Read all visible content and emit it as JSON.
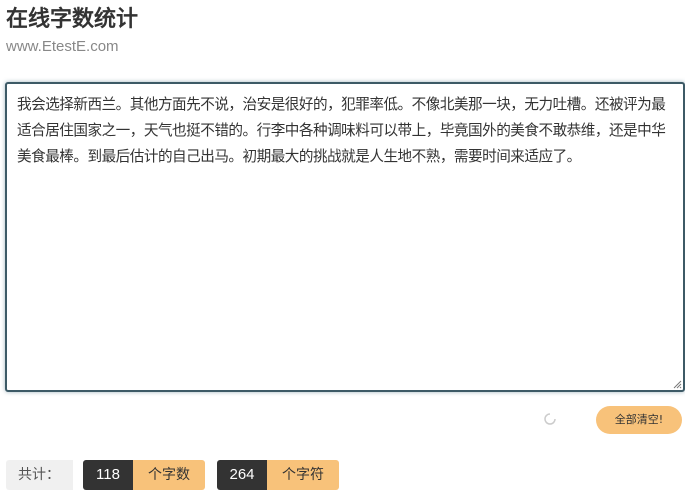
{
  "header": {
    "title": "在线字数统计",
    "subtitle": "www.EtestE.com"
  },
  "editor": {
    "value": "我会选择新西兰。其他方面先不说，治安是很好的，犯罪率低。不像北美那一块，无力吐槽。还被评为最适合居住国家之一，天气也挺不错的。行李中各种调味料可以带上，毕竟国外的美食不敢恭维，还是中华美食最棒。到最后估计的自己出马。初期最大的挑战就是人生地不熟，需要时间来适应了。"
  },
  "actions": {
    "clear_label": "全部清空!"
  },
  "stats": {
    "label": "共计：",
    "words_count": "118",
    "words_unit": "个字数",
    "chars_count": "264",
    "chars_unit": "个字符"
  },
  "colors": {
    "accent": "#f8c27a",
    "dark": "#333333",
    "border": "#3d5a66"
  }
}
